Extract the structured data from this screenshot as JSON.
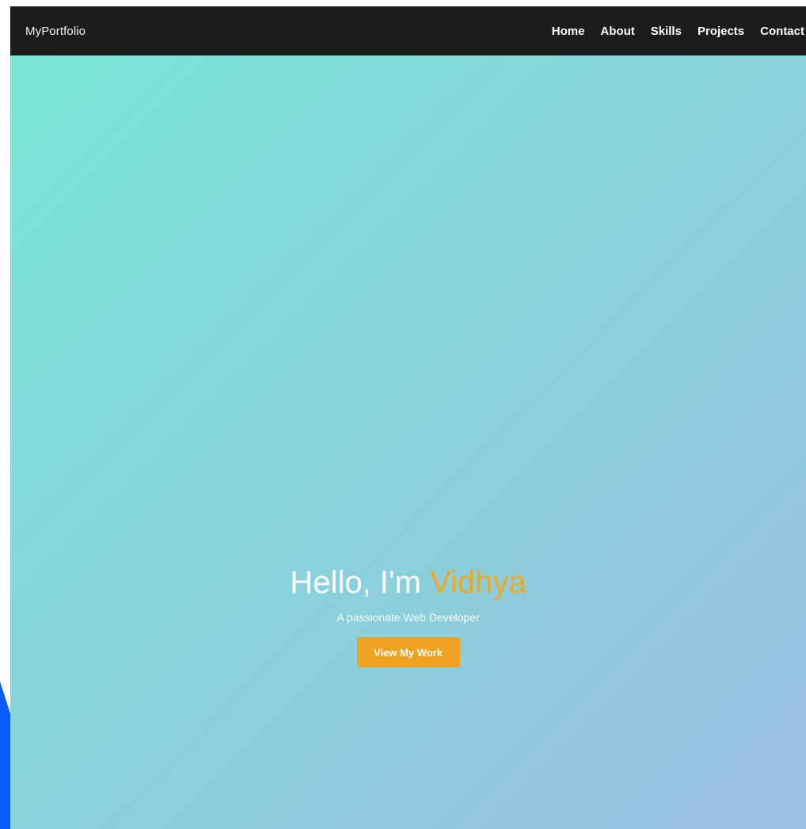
{
  "header": {
    "brand": "MyPortfolio",
    "nav": [
      {
        "label": "Home"
      },
      {
        "label": "About"
      },
      {
        "label": "Skills"
      },
      {
        "label": "Projects"
      },
      {
        "label": "Contact"
      }
    ]
  },
  "hero": {
    "greeting": "Hello, I'm ",
    "name": "Vidhya",
    "subtitle": "A passionate Web Developer",
    "cta_label": "View My Work"
  },
  "colors": {
    "navbar": "#1c1c1c",
    "accent": "#eea21f",
    "gradient_start": "#77e6d6",
    "gradient_end": "#9bbfe1",
    "side_accent": "#0a5cff"
  }
}
